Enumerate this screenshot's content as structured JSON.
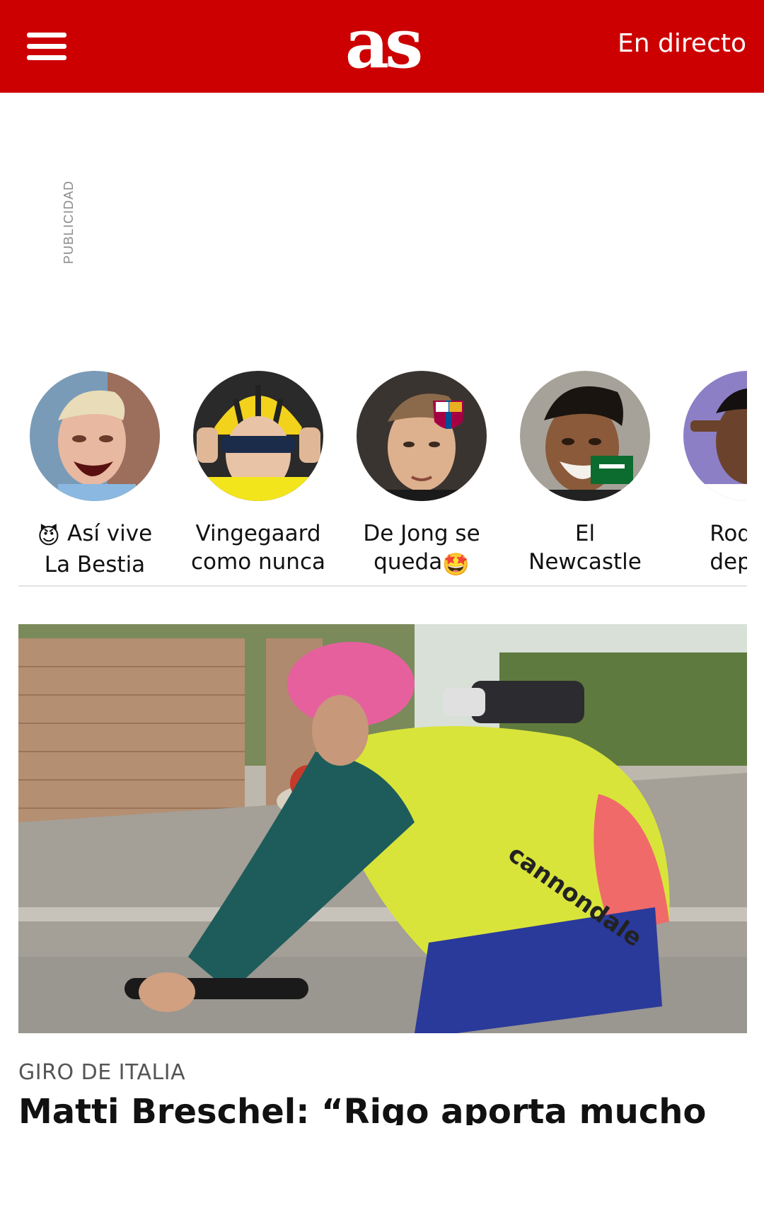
{
  "header": {
    "menu_icon": "hamburger-menu-icon",
    "logo_text": "as",
    "live_label": "En directo",
    "background_color": "#cc0000"
  },
  "ad": {
    "label": "PUBLICIDAD"
  },
  "stories": [
    {
      "line1": "Así vive",
      "line2": "La Bestia",
      "emoji": "😈"
    },
    {
      "line1": "Vingegaard",
      "line2": "como nunca"
    },
    {
      "line1": "De Jong se",
      "line2": "queda",
      "emoji": "🤩"
    },
    {
      "line1": "El",
      "line2": "Newcastle"
    },
    {
      "line1": "Rodryg",
      "line2": "depred"
    }
  ],
  "article": {
    "kicker": "GIRO DE ITALIA",
    "headline": "Matti Breschel: “Rigo aporta mucho"
  }
}
